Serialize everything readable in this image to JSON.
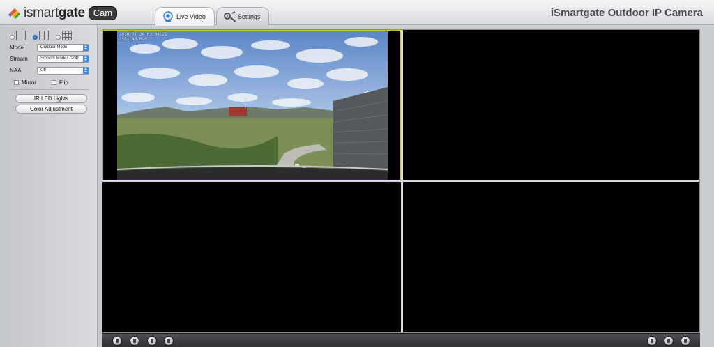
{
  "header": {
    "logo_prefix": "ismart",
    "logo_suffix": "gate",
    "logo_badge": "Cam",
    "app_title": "iSmartgate Outdoor IP Camera",
    "tabs": [
      {
        "label": "Live Video",
        "icon": "webcam-icon",
        "active": true
      },
      {
        "label": "Settings",
        "icon": "wrench-icon",
        "active": false
      }
    ]
  },
  "sidebar": {
    "split_options": [
      {
        "icon": "single-view-icon",
        "selected": false
      },
      {
        "icon": "quad-view-icon",
        "selected": true
      },
      {
        "icon": "nine-view-icon",
        "selected": false
      }
    ],
    "mode_label": "Mode",
    "mode_value": "Outdoor Mode",
    "stream_label": "Stream",
    "stream_value": "Smooth Mode/ 720P",
    "naa_label": "NAA",
    "naa_value": "Off",
    "mirror_label": "Mirror",
    "flip_label": "Flip",
    "ir_button": "IR LED Lights",
    "color_button": "Color Adjustment"
  },
  "video": {
    "osd_timestamp": "2016-07-24 03:04:29",
    "osd_camera": "iSG-CAM-020"
  },
  "controls": {
    "left_icons": [
      "play-icon",
      "stop-icon",
      "record-icon",
      "snapshot-icon"
    ],
    "right_icons": [
      "fullscreen-icon",
      "audio-icon",
      "talk-icon"
    ]
  },
  "colors": {
    "accent": "#2f7fd8",
    "active_tile_border": "#c8c03a"
  }
}
